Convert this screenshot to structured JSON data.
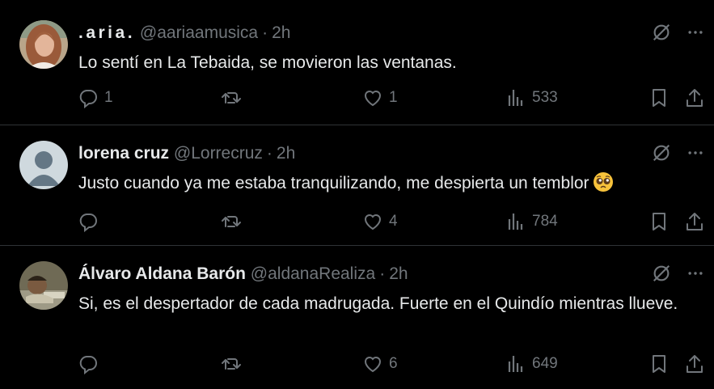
{
  "tweets": [
    {
      "name": ".aria.",
      "handle": "@aariaamusica",
      "separator": "·",
      "time": "2h",
      "text": "Lo sentí en La Tebaida, se movieron las ventanas.",
      "replies": "1",
      "retweets": "",
      "likes": "1",
      "views": "533",
      "avatar": "woman-portrait"
    },
    {
      "name": "lorena cruz",
      "handle": "@Lorrecruz",
      "separator": "·",
      "time": "2h",
      "text": "Justo cuando ya me estaba tranquilizando, me despierta un temblor",
      "emoji": "pleading-face-icon",
      "replies": "",
      "retweets": "",
      "likes": "4",
      "views": "784",
      "avatar": "default-profile"
    },
    {
      "name": "Álvaro Aldana Barón",
      "handle": "@aldanaRealiza",
      "separator": "·",
      "time": "2h",
      "text": "Si, es el despertador de cada madrugada. Fuerte en el Quindío mientras llueve.",
      "replies": "",
      "retweets": "",
      "likes": "6",
      "views": "649",
      "avatar": "man-portrait"
    }
  ],
  "colors": {
    "background": "#000000",
    "text": "#e7e9ea",
    "secondary": "#71767b",
    "divider": "#2f3336"
  }
}
